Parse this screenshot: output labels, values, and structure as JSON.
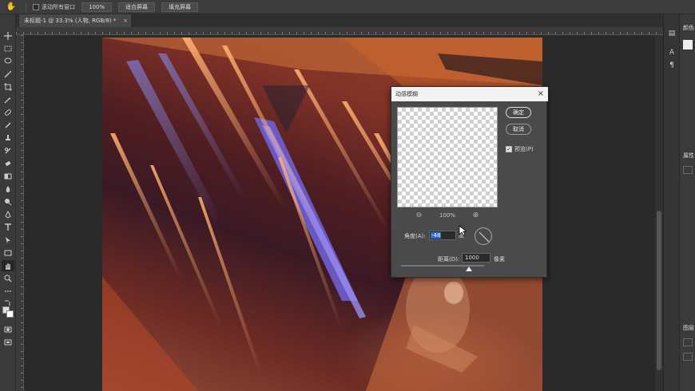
{
  "options_bar": {
    "scroll_all_label": "滚动所有窗口",
    "zoom_100_label": "100%",
    "fit_screen_label": "适合屏幕",
    "fill_screen_label": "填充屏幕"
  },
  "document": {
    "tab_title": "未标题-1 @ 33.3% (人物, RGB/8) *",
    "tab_close": "×"
  },
  "tools": [
    "move-icon",
    "marquee-icon",
    "lasso-icon",
    "magic-wand-icon",
    "crop-icon",
    "eyedropper-icon",
    "healing-icon",
    "brush-icon",
    "stamp-icon",
    "history-brush-icon",
    "eraser-icon",
    "gradient-icon",
    "blur-icon",
    "dodge-icon",
    "pen-icon",
    "type-icon",
    "path-select-icon",
    "shape-icon",
    "hand-icon",
    "zoom-icon",
    "more-icon",
    "swap-colors-icon",
    "color-swatches-icon",
    "quick-mask-icon",
    "screen-mode-icon"
  ],
  "panels": {
    "color_title": "颜色",
    "properties_title": "属性",
    "layers_title": "图层"
  },
  "dialog": {
    "title": "动感模糊",
    "close": "×",
    "ok_label": "确定",
    "cancel_label": "取消",
    "preview_label": "预览(P)",
    "preview_checked": true,
    "zoom_level": "100%",
    "angle_label": "角度(A):",
    "angle_value": "-48",
    "angle_unit": "度",
    "distance_label": "距离(D):",
    "distance_value": "1000",
    "distance_unit": "像素"
  },
  "colors": {
    "ui_dark": "#282828",
    "panel": "#3c3c3c",
    "dialog_bg": "#4a4a4a",
    "selection_blue": "#2f6ad0"
  }
}
